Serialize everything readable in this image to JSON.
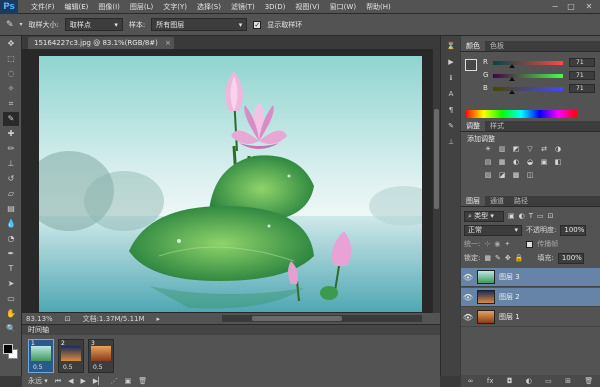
{
  "app": {
    "logo": "Ps"
  },
  "menubar": {
    "items": [
      "文件(F)",
      "编辑(E)",
      "图像(I)",
      "图层(L)",
      "文字(Y)",
      "选择(S)",
      "滤镜(T)",
      "3D(D)",
      "视图(V)",
      "窗口(W)",
      "帮助(H)"
    ],
    "window_controls": [
      "−",
      "□",
      "✕"
    ]
  },
  "options": {
    "sample_size_label": "取样大小:",
    "sample_size_value": "取样点",
    "sample_label": "样本:",
    "sample_value": "所有图层",
    "show_ring_label": "显示取样环",
    "show_ring_checked": "✓"
  },
  "document": {
    "tab_title": "15164227c3.jpg @ 83.1%(RGB/8#)",
    "close": "×",
    "zoom": "83.13%",
    "doc_info": "文档:1.37M/5.11M"
  },
  "timeline": {
    "title": "时间轴",
    "loop": "永远",
    "frames": [
      {
        "num": "1",
        "delay": "0.5"
      },
      {
        "num": "2",
        "delay": "0.5"
      },
      {
        "num": "3",
        "delay": "0.5"
      }
    ]
  },
  "color_panel": {
    "tabs": [
      "颜色",
      "色板"
    ],
    "r_label": "R",
    "r_value": "71",
    "g_label": "G",
    "g_value": "71",
    "b_label": "B",
    "b_value": "71",
    "level_fraction": 0.278,
    "foreground_color": "#474747"
  },
  "adjustments_panel": {
    "tabs": [
      "调整",
      "样式"
    ],
    "title": "添加调整",
    "icons": [
      "☀",
      "▥",
      "◩",
      "▽",
      "⇄",
      "◑",
      "▤",
      "▦",
      "◐",
      "◒",
      "▣",
      "◧",
      "▨",
      "◪",
      "▩",
      "◫"
    ]
  },
  "layers_panel": {
    "tabs": [
      "图层",
      "通道",
      "路径"
    ],
    "kind": "类型",
    "blend_mode": "正常",
    "opacity_label": "不透明度:",
    "opacity_value": "100%",
    "unify_label": "统一:",
    "propagate_label": "传播帧",
    "lock_label": "锁定:",
    "fill_label": "填充:",
    "fill_value": "100%",
    "layers": [
      {
        "name": "图层 3"
      },
      {
        "name": "图层 2"
      },
      {
        "name": "图层 1"
      }
    ],
    "footer_icons": [
      "∞",
      "fx",
      "◘",
      "◐",
      "▭",
      "⊞",
      "🗑"
    ]
  }
}
